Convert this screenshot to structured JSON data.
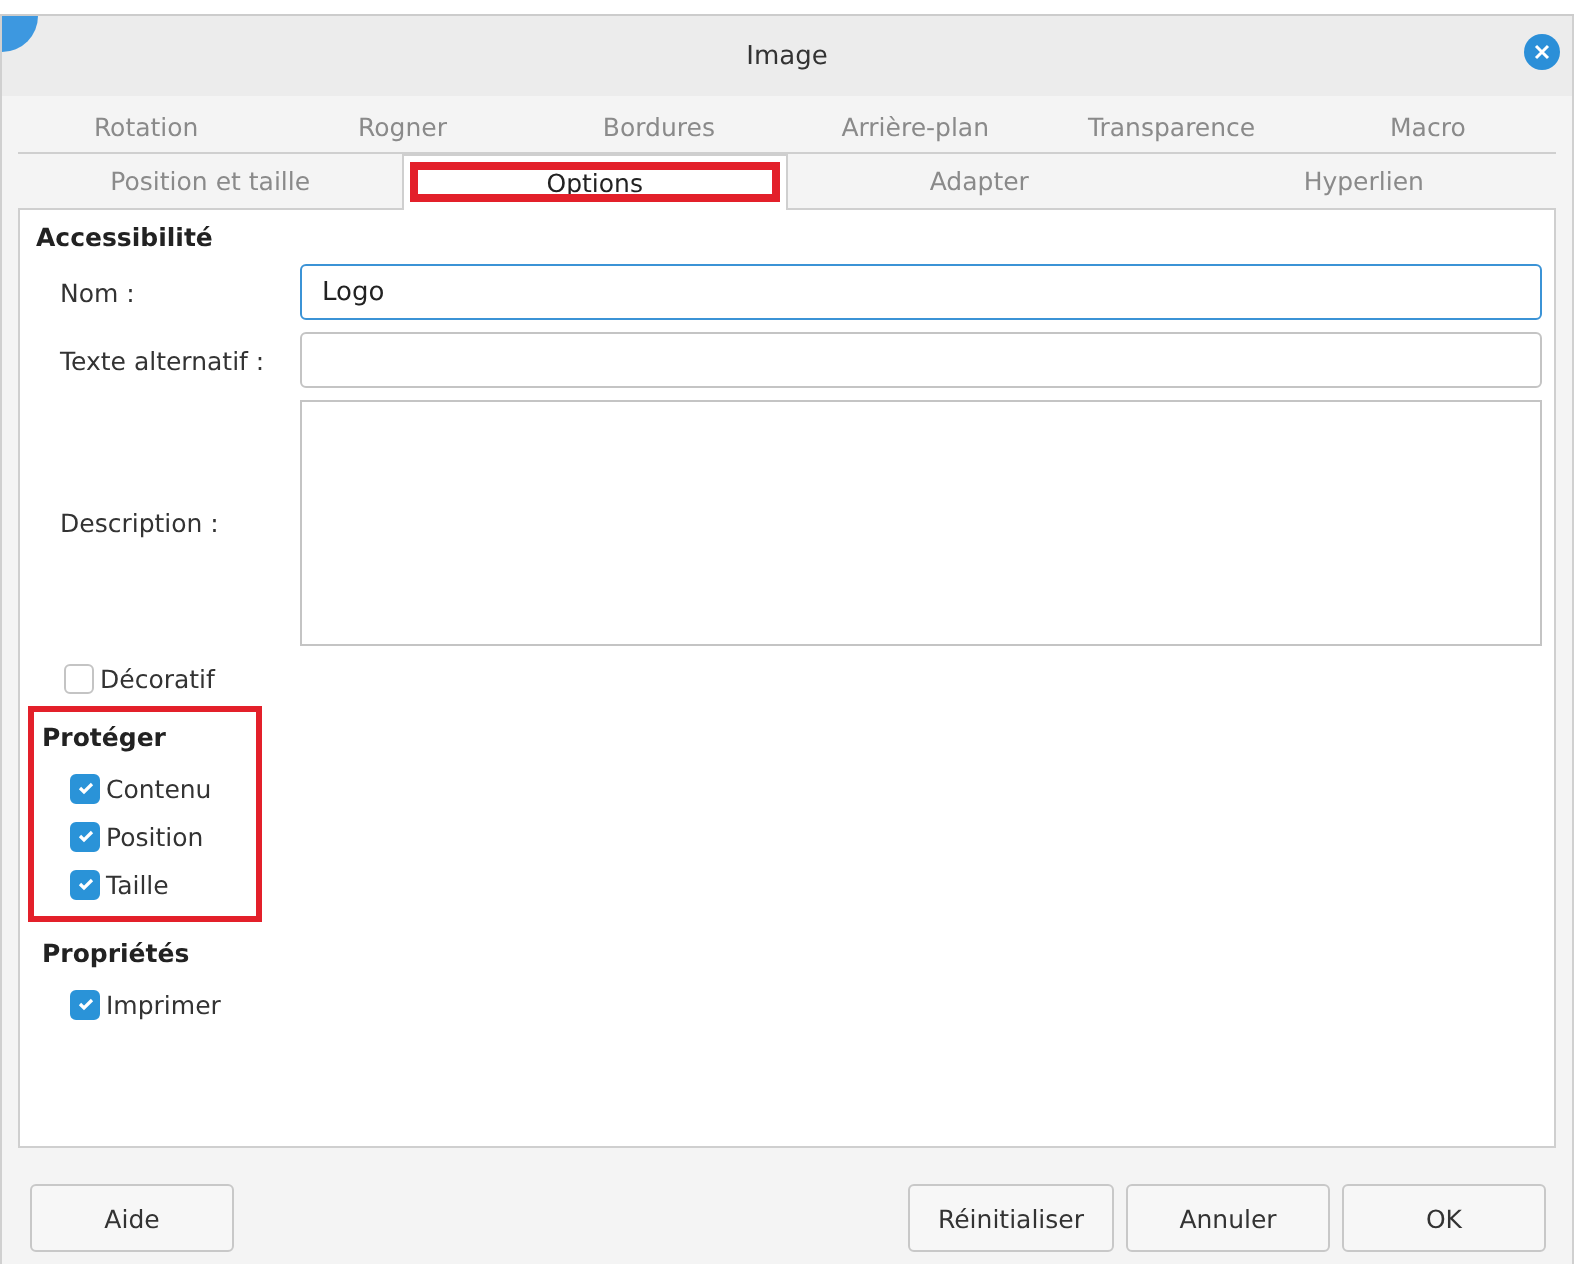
{
  "window": {
    "title": "Image"
  },
  "tab_rows": [
    [
      {
        "label": "Rotation",
        "selected": false,
        "highlighted": false
      },
      {
        "label": "Rogner",
        "selected": false,
        "highlighted": false
      },
      {
        "label": "Bordures",
        "selected": false,
        "highlighted": false
      },
      {
        "label": "Arrière-plan",
        "selected": false,
        "highlighted": false
      },
      {
        "label": "Transparence",
        "selected": false,
        "highlighted": false
      },
      {
        "label": "Macro",
        "selected": false,
        "highlighted": false
      }
    ],
    [
      {
        "label": "Position et taille",
        "selected": false,
        "highlighted": false
      },
      {
        "label": "Options",
        "selected": true,
        "highlighted": true
      },
      {
        "label": "Adapter",
        "selected": false,
        "highlighted": false
      },
      {
        "label": "Hyperlien",
        "selected": false,
        "highlighted": false
      }
    ]
  ],
  "accessibility": {
    "heading": "Accessibilité",
    "fields": [
      {
        "label": "Nom :",
        "value": "Logo",
        "kind": "line",
        "focused": true
      },
      {
        "label": "Texte alternatif :",
        "kind": "line",
        "focused": false
      },
      {
        "label": "Description :",
        "kind": "area",
        "focused": false
      }
    ],
    "decorative": {
      "label": "Décoratif",
      "checked": false
    }
  },
  "protect": {
    "heading": "Protéger",
    "highlighted": true,
    "items": [
      {
        "label": "Contenu",
        "checked": true
      },
      {
        "label": "Position",
        "checked": true
      },
      {
        "label": "Taille",
        "checked": true
      }
    ]
  },
  "properties": {
    "heading": "Propriétés",
    "items": [
      {
        "label": "Imprimer",
        "checked": true
      }
    ]
  },
  "buttons_left": [
    "Aide"
  ],
  "buttons_right": [
    "Réinitialiser",
    "Annuler",
    "OK"
  ]
}
